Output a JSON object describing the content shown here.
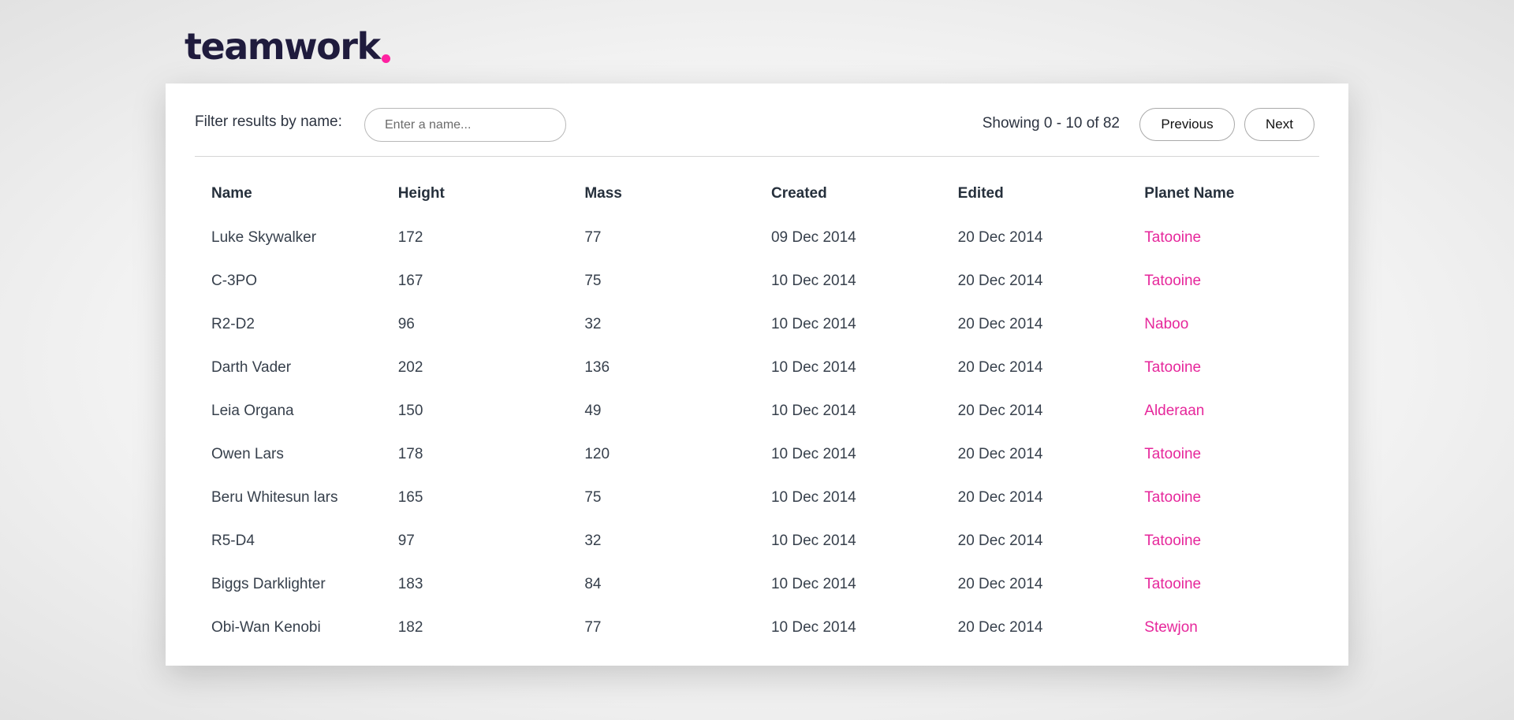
{
  "brand": {
    "logo_text": "teamwork",
    "accent_color": "#ff22a1"
  },
  "filter": {
    "label": "Filter results by name:",
    "placeholder": "Enter a name...",
    "value": ""
  },
  "pagination": {
    "showing_text": "Showing 0 - 10 of 82",
    "previous_label": "Previous",
    "next_label": "Next"
  },
  "table": {
    "headers": [
      "Name",
      "Height",
      "Mass",
      "Created",
      "Edited",
      "Planet Name"
    ],
    "rows": [
      [
        "Luke Skywalker",
        "172",
        "77",
        "09 Dec 2014",
        "20 Dec 2014",
        "Tatooine"
      ],
      [
        "C-3PO",
        "167",
        "75",
        "10 Dec 2014",
        "20 Dec 2014",
        "Tatooine"
      ],
      [
        "R2-D2",
        "96",
        "32",
        "10 Dec 2014",
        "20 Dec 2014",
        "Naboo"
      ],
      [
        "Darth Vader",
        "202",
        "136",
        "10 Dec 2014",
        "20 Dec 2014",
        "Tatooine"
      ],
      [
        "Leia Organa",
        "150",
        "49",
        "10 Dec 2014",
        "20 Dec 2014",
        "Alderaan"
      ],
      [
        "Owen Lars",
        "178",
        "120",
        "10 Dec 2014",
        "20 Dec 2014",
        "Tatooine"
      ],
      [
        "Beru Whitesun lars",
        "165",
        "75",
        "10 Dec 2014",
        "20 Dec 2014",
        "Tatooine"
      ],
      [
        "R5-D4",
        "97",
        "32",
        "10 Dec 2014",
        "20 Dec 2014",
        "Tatooine"
      ],
      [
        "Biggs Darklighter",
        "183",
        "84",
        "10 Dec 2014",
        "20 Dec 2014",
        "Tatooine"
      ],
      [
        "Obi-Wan Kenobi",
        "182",
        "77",
        "10 Dec 2014",
        "20 Dec 2014",
        "Stewjon"
      ]
    ]
  },
  "colors": {
    "planet_link": "#e6279b",
    "text": "#37404c",
    "logo_text": "#1f1b3d"
  }
}
